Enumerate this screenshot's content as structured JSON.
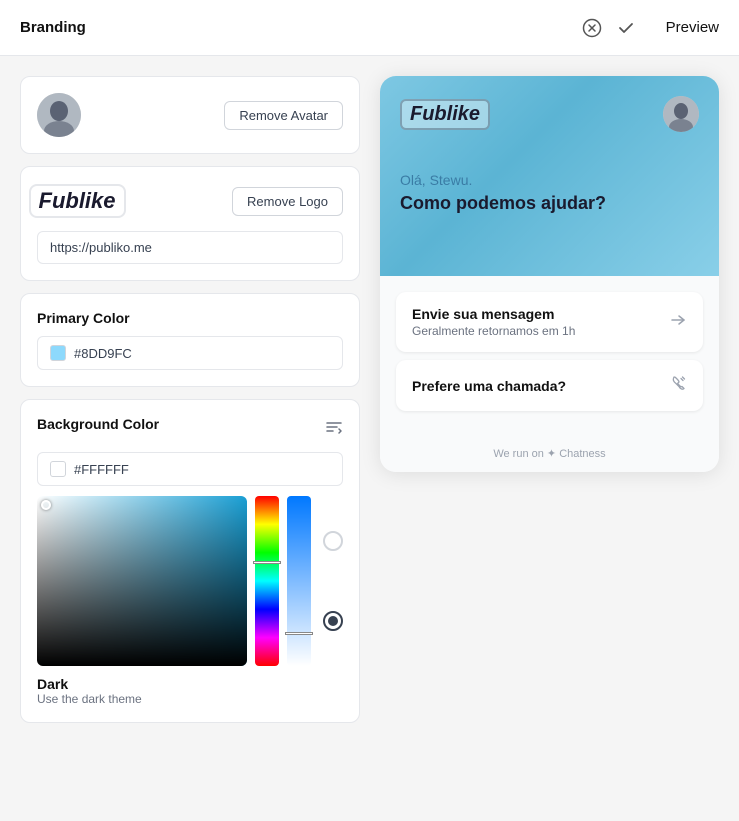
{
  "header": {
    "title": "Branding",
    "preview_label": "Preview"
  },
  "left": {
    "remove_avatar_btn": "Remove Avatar",
    "remove_logo_btn": "Remove Logo",
    "url_value": "https://publiko.me",
    "url_placeholder": "https://publiko.me",
    "primary_color": {
      "label": "Primary Color",
      "value": "#8DD9FC",
      "swatch_color": "#8DD9FC"
    },
    "background_color": {
      "label": "Background Color",
      "value": "#FFFFFF",
      "swatch_color": "#FFFFFF"
    },
    "theme_light": {
      "label": "",
      "desc": ""
    },
    "theme_dark": {
      "label": "Dark",
      "desc": "Use the dark theme"
    }
  },
  "preview": {
    "logo": "Fublike",
    "greeting": "Olá, Stewu.",
    "question": "Como podemos ajudar?",
    "option1_title": "Envie sua mensagem",
    "option1_sub": "Geralmente retornamos em 1h",
    "option2_title": "Prefere uma chamada?",
    "footer": "We run on ✦ Chatness"
  }
}
